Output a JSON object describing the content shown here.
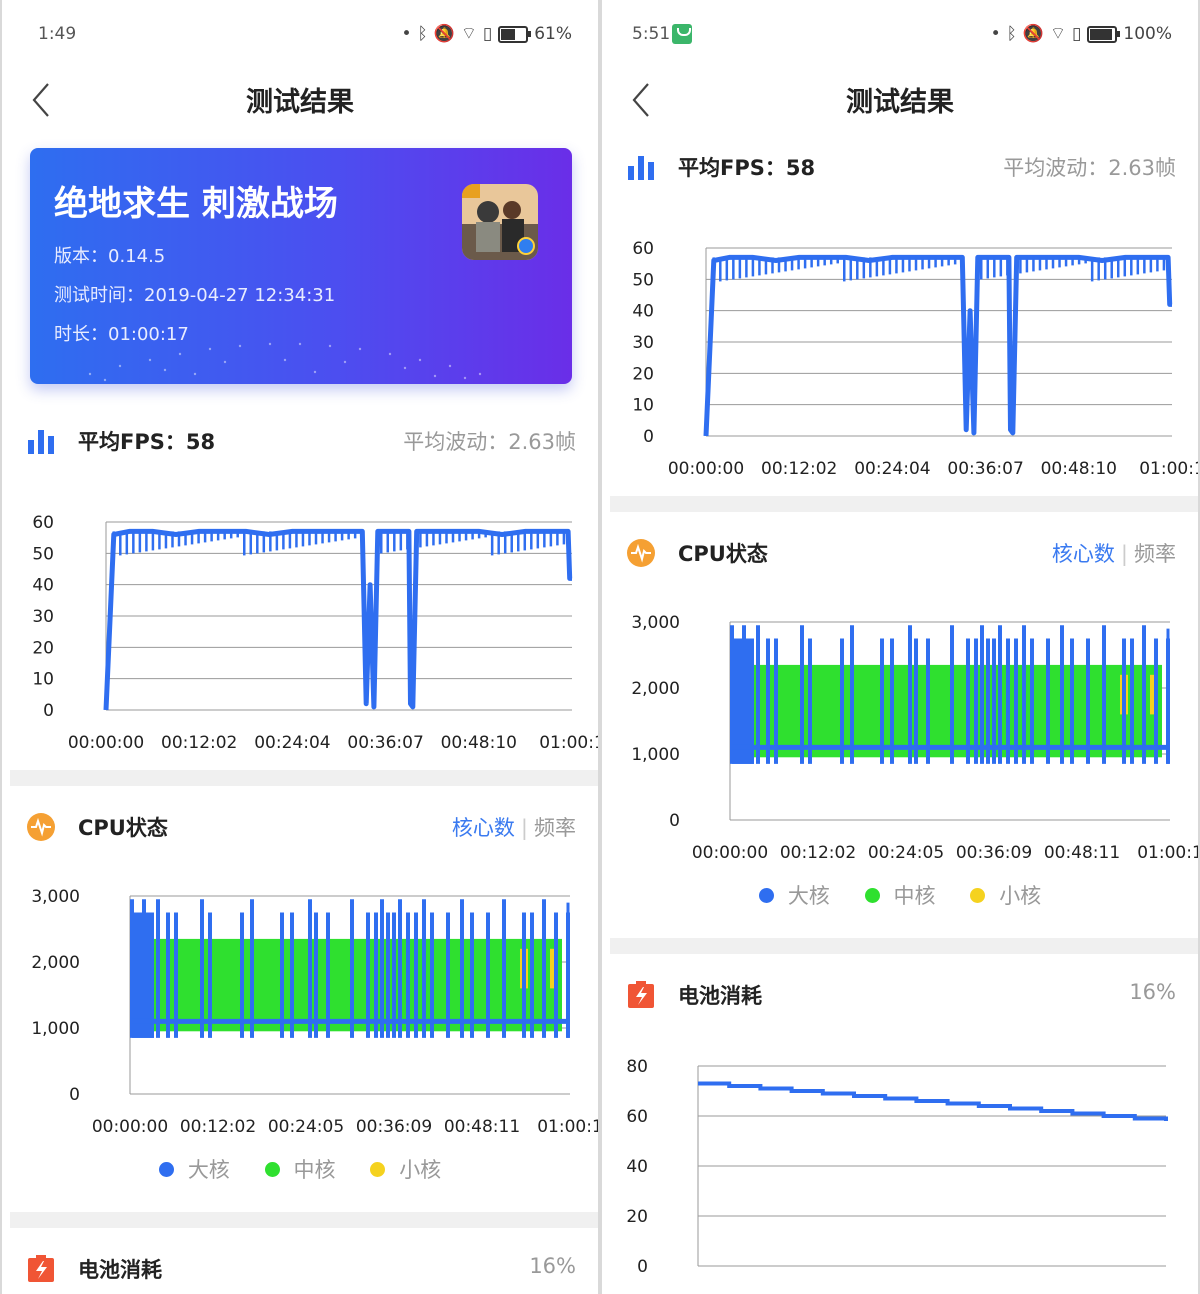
{
  "left": {
    "status": {
      "time": "1:49",
      "battery_text": "61%",
      "battery_level": 0.61
    },
    "nav": {
      "title": "测试结果"
    },
    "game": {
      "name": "绝地求生 刺激战场",
      "version": "版本：0.14.5",
      "test_time": "测试时间：2019-04-27 12:34:31",
      "duration": "时长：01:00:17"
    },
    "fps_section": {
      "title": "平均FPS：58",
      "right": "平均波动：2.63帧"
    },
    "cpu_section": {
      "title": "CPU状态",
      "tab_cores": "核心数",
      "tab_freq": "频率"
    },
    "legend": {
      "big": "大核",
      "mid": "中核",
      "small": "小核"
    },
    "battery_section": {
      "title": "电池消耗",
      "right": "16%"
    }
  },
  "right": {
    "status": {
      "time": "5:51",
      "battery_text": "100%",
      "battery_level": 1.0
    },
    "nav": {
      "title": "测试结果"
    },
    "fps_section": {
      "title": "平均FPS：58",
      "right": "平均波动：2.63帧"
    },
    "cpu_section": {
      "title": "CPU状态",
      "tab_cores": "核心数",
      "tab_freq": "频率"
    },
    "legend": {
      "big": "大核",
      "mid": "中核",
      "small": "小核"
    },
    "battery_section": {
      "title": "电池消耗",
      "right": "16%"
    }
  },
  "colors": {
    "accent": "#3a7af0",
    "big_core": "#2f6ef0",
    "mid_core": "#2fe02f",
    "small_core": "#f5d21f",
    "fps_line": "#2f6ef0",
    "cpu_icon": "#f5a033",
    "battery_icon": "#f05535"
  },
  "icons": [
    "back-chevron",
    "bar-chart",
    "pulse-circle",
    "battery-bolt",
    "bluetooth",
    "mute",
    "wifi",
    "alert",
    "battery"
  ],
  "chart_data": [
    {
      "id": "fps",
      "type": "line",
      "ylim": [
        0,
        60
      ],
      "yticks": [
        "0",
        "10",
        "20",
        "30",
        "40",
        "50",
        "60"
      ],
      "xticks": [
        "00:00:00",
        "00:12:02",
        "00:24:04",
        "00:36:07",
        "00:48:10",
        "01:00:1"
      ],
      "series": [
        {
          "color": "#2f6ef0",
          "x": [
            0,
            1,
            3,
            6,
            9,
            12,
            15,
            18,
            21,
            24,
            27,
            30,
            33,
            33.2,
            33.5,
            34,
            34.5,
            35,
            37,
            39,
            39.2,
            39.5,
            40,
            42,
            45,
            48,
            51,
            54,
            57,
            59.5,
            59.7,
            60
          ],
          "y": [
            0,
            56,
            57,
            57,
            56,
            57,
            57,
            57,
            56,
            57,
            57,
            57,
            57,
            35,
            2,
            40,
            1,
            57,
            57,
            57,
            2,
            1,
            57,
            57,
            57,
            57,
            56,
            57,
            57,
            57,
            42,
            42
          ]
        }
      ]
    },
    {
      "id": "cpu",
      "type": "area",
      "ylim": [
        0,
        3000
      ],
      "yticks": [
        "0",
        "1,000",
        "2,000",
        "3,000"
      ],
      "xticks": [
        "00:00:00",
        "00:12:02",
        "00:24:05",
        "00:36:09",
        "00:48:11",
        "01:00:1"
      ],
      "bands": [
        {
          "name": "中核",
          "color": "#2fe02f",
          "low": 950,
          "high": 2350
        },
        {
          "name": "大核",
          "color": "#2f6ef0",
          "low": 850,
          "high": 2750
        },
        {
          "name": "小核",
          "color": "#f5d21f",
          "low": 1600,
          "high": 2200
        }
      ]
    },
    {
      "id": "battery",
      "type": "line",
      "ylim": [
        0,
        80
      ],
      "yticks": [
        "0",
        "20",
        "40",
        "60",
        "80"
      ],
      "xticks": [],
      "series": [
        {
          "color": "#2f6ef0",
          "x": [
            0,
            60
          ],
          "y": [
            73,
            58
          ]
        }
      ]
    }
  ]
}
